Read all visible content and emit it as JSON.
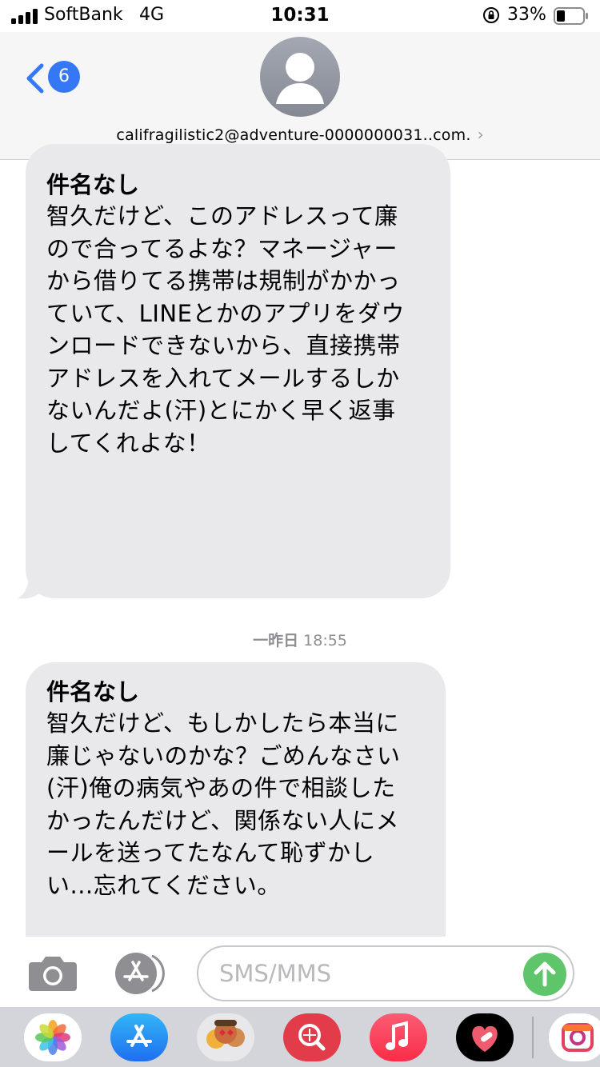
{
  "status_bar": {
    "carrier": "SoftBank",
    "network": "4G",
    "time": "10:31",
    "battery_percent": "33%",
    "battery_level": 0.33,
    "icons": [
      "signal-icon",
      "orientation-lock-icon",
      "battery-icon"
    ]
  },
  "header": {
    "back_badge_count": "6",
    "contact": "califragilistic2@adventure-0000000031..com.",
    "contact_chevron": "›",
    "icons": [
      "back-chevron-icon",
      "avatar-icon",
      "chevron-right-icon"
    ],
    "accent_color": "#3478f6"
  },
  "messages": [
    {
      "subject": "件名なし",
      "lines": [
        "智久だけど、このアドレスって廉",
        "ので合ってるよな？マネージャー",
        "から借りてる携帯は規制がかかっ",
        "ていて、LINEとかのアプリをダウ",
        "ンロードできないから、直接携帯",
        "アドレスを入れてメールするしか",
        "ないんだよ(汗)とにかく早く返事",
        "してくれよな！"
      ]
    },
    {
      "subject": "件名なし",
      "lines": [
        "智久だけど、もしかしたら本当に",
        "廉じゃないのかな？ごめんなさい",
        "(汗)俺の病気やあの件で相談した",
        "かったんだけど、関係ない人にメ",
        "ールを送ってたなんて恥ずかし",
        "い...忘れてください。"
      ]
    }
  ],
  "timestamp": {
    "day": "一昨日",
    "time": "18:55"
  },
  "compose": {
    "placeholder": "SMS/MMS",
    "icons": [
      "camera-icon",
      "app-store-icon",
      "send-arrow-icon"
    ],
    "send_color": "#5ec56b"
  },
  "app_drawer": {
    "icons": [
      "photos-icon",
      "app-store-icon",
      "memoji-icon",
      "web-search-icon",
      "music-icon",
      "heart-sticker-icon",
      "camera-effects-icon"
    ]
  },
  "colors": {
    "bubble": "#e9e9eb",
    "header_bg": "#f6f6f6",
    "drawer_bg": "#d3d5da"
  }
}
